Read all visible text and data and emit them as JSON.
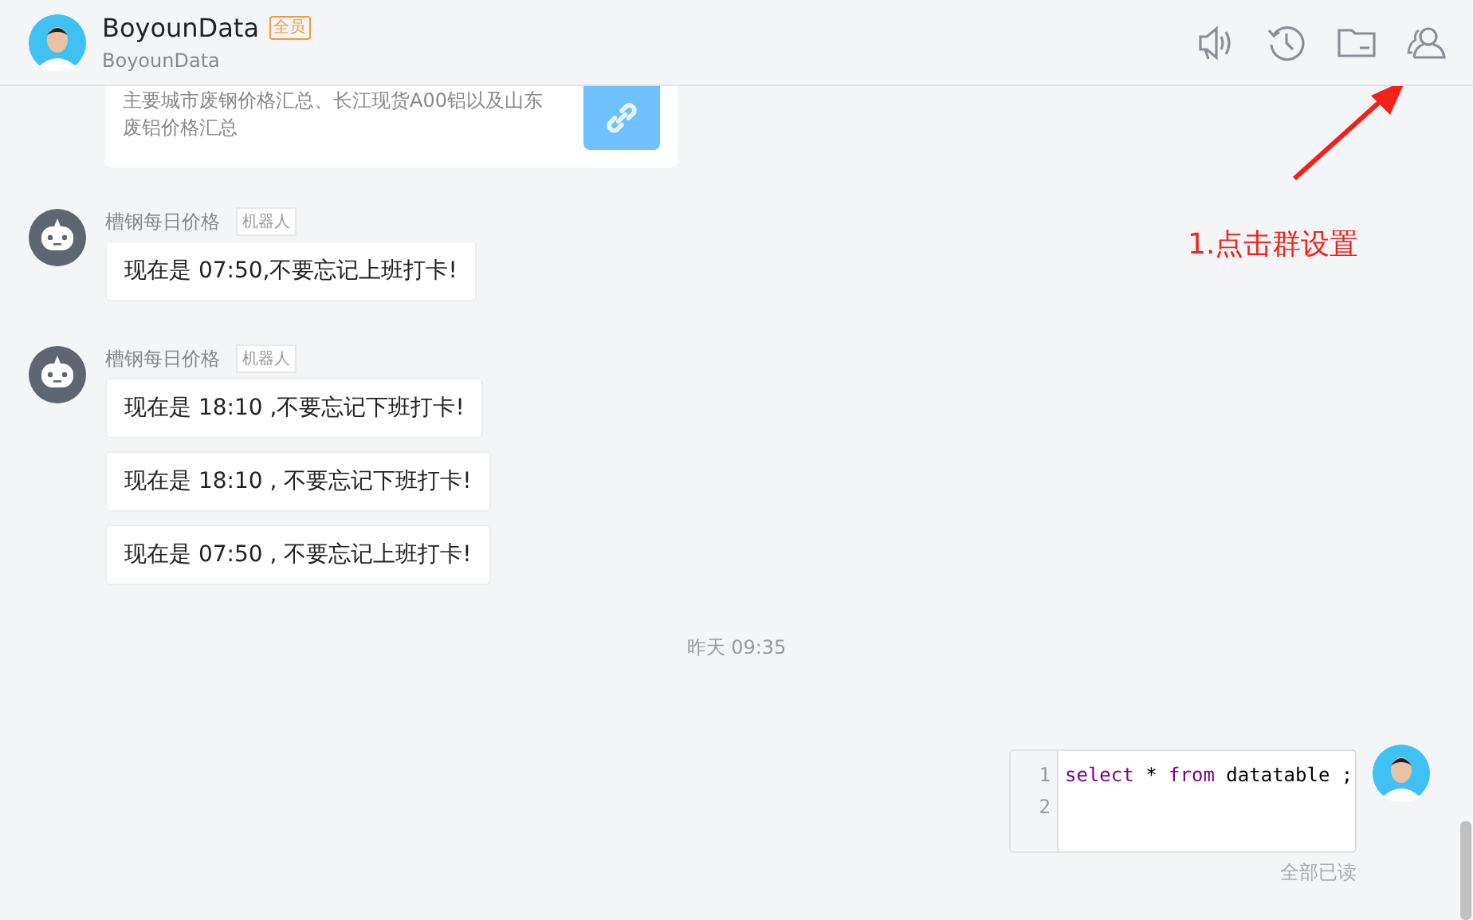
{
  "header": {
    "title": "BoyounData",
    "badge": "全员",
    "subtitle": "BoyounData"
  },
  "link_card": {
    "lines": [
      "主要城市废钢价格汇总、长江现货A00铝以及山东",
      "废铝价格汇总"
    ]
  },
  "groups": [
    {
      "sender": "槽钢每日价格",
      "tag": "机器人",
      "messages": [
        "现在是 07:50,不要忘记上班打卡!"
      ]
    },
    {
      "sender": "槽钢每日价格",
      "tag": "机器人",
      "messages": [
        "现在是 18:10 ,不要忘记下班打卡!",
        "现在是 18:10 , 不要忘记下班打卡!",
        "现在是 07:50 , 不要忘记上班打卡!"
      ]
    }
  ],
  "time_divider": "昨天 09:35",
  "own_message": {
    "lines": [
      {
        "number": "1",
        "tokens": [
          {
            "kind": "keyword",
            "text": "select"
          },
          {
            "kind": "plain",
            "text": " * "
          },
          {
            "kind": "keyword",
            "text": "from"
          },
          {
            "kind": "plain",
            "text": " datatable ;"
          }
        ]
      },
      {
        "number": "2"
      }
    ],
    "read_status": "全部已读"
  },
  "annotation": {
    "text": "1.点击群设置"
  }
}
